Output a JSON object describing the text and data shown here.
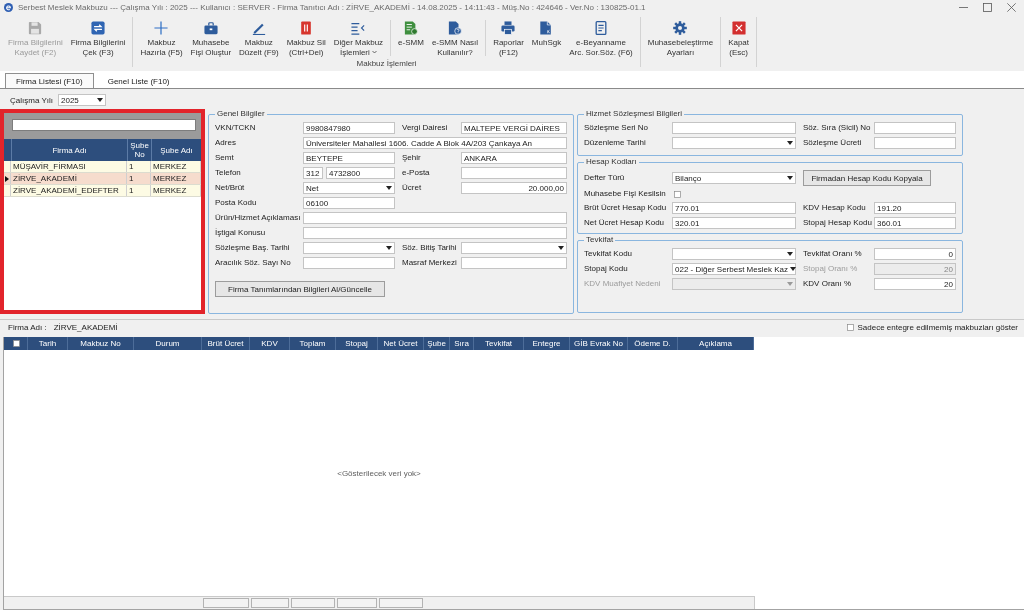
{
  "window": {
    "title": "Serbest Meslek Makbuzu --- Çalışma Yılı : 2025 --- Kullanıcı : SERVER - Firma Tanıtıcı Adı : ZİRVE_AKADEMİ - 14.08.2025 - 14:11:43 - Müş.No : 424646 - Ver.No : 130825-01.1"
  },
  "toolbar": {
    "groups": [
      {
        "sections": [
          [
            {
              "kind": "save",
              "label": "Firma Bilgilerini\nKaydet (F2)",
              "disabled": true,
              "menu": false
            },
            {
              "kind": "sync",
              "label": "Firma Bilgilerini\nÇek (F3)",
              "disabled": false,
              "menu": false
            }
          ]
        ]
      },
      {
        "label": "Makbuz İşlemleri",
        "sections": [
          [
            {
              "kind": "add",
              "label": "Makbuz\nHazırla (F5)",
              "disabled": false,
              "menu": false
            },
            {
              "kind": "briefcase",
              "label": "Muhasebe\nFişi Oluştur",
              "disabled": false,
              "menu": false
            },
            {
              "kind": "edit",
              "label": "Makbuz\nDüzelt (F9)",
              "disabled": false,
              "menu": false
            },
            {
              "kind": "delete",
              "label": "Makbuz Sil\n(Ctrl+Del)",
              "disabled": false,
              "menu": false
            },
            {
              "kind": "list",
              "label": "Diğer Makbuz\nİşlemleri",
              "disabled": false,
              "menu": true
            }
          ],
          [
            {
              "kind": "smm",
              "label": "e-SMM",
              "disabled": false,
              "menu": false
            },
            {
              "kind": "help",
              "label": "e-SMM Nasıl\nKullanılır?",
              "disabled": false,
              "menu": false
            }
          ],
          [
            {
              "kind": "print",
              "label": "Raporlar\n(F12)",
              "disabled": false,
              "menu": false
            },
            {
              "kind": "report",
              "label": "MuhSgk",
              "disabled": false,
              "menu": false
            },
            {
              "kind": "declaration",
              "label": "e-Beyanname\nArc. Sor.Söz. (F6)",
              "disabled": false,
              "menu": false
            }
          ]
        ]
      },
      {
        "sections": [
          [
            {
              "kind": "settings",
              "label": "Muhasebeleştirme\nAyarları",
              "disabled": false,
              "menu": false
            }
          ]
        ]
      },
      {
        "sections": [
          [
            {
              "kind": "close",
              "label": "Kapat\n(Esc)",
              "disabled": false,
              "menu": false
            }
          ]
        ]
      }
    ]
  },
  "tabs": [
    {
      "label": "Firma Listesi (F10)",
      "selected": true
    },
    {
      "label": "Genel Liste (F10)",
      "selected": false
    }
  ],
  "work_year": {
    "label": "Çalışma Yılı",
    "value": "2025"
  },
  "firm_list": {
    "columns": [
      "Firma Adı",
      "Şube\nNo",
      "Şube Adı"
    ],
    "rows": [
      {
        "cells": [
          "MÜŞAVİR_FİRMASI",
          "1",
          "MERKEZ"
        ],
        "selected": false
      },
      {
        "cells": [
          "ZİRVE_AKADEMİ",
          "1",
          "MERKEZ"
        ],
        "selected": true
      },
      {
        "cells": [
          "ZİRVE_AKADEMİ_EDEFTER",
          "1",
          "MERKEZ"
        ],
        "selected": false
      }
    ]
  },
  "general_info": {
    "title": "Genel Bilgiler",
    "rows": [
      [
        {
          "label": "VKN/TCKN",
          "kind": "text",
          "value": "9980847980"
        },
        {
          "label": "Vergi Dairesi",
          "kind": "text",
          "value": "MALTEPE VERGİ DAİRES"
        }
      ],
      [
        {
          "label": "Adres",
          "kind": "wide",
          "value": "Üniversiteler Mahallesi 1606. Cadde A Blok 4A/203 Çankaya An"
        }
      ],
      [
        {
          "label": "Semt",
          "kind": "text",
          "value": "BEYTEPE"
        },
        {
          "label": "Şehir",
          "kind": "text",
          "value": "ANKARA"
        }
      ],
      [
        {
          "label": "Telefon",
          "kind": "phone",
          "area_code": "312",
          "value": "4732800"
        },
        {
          "label": "e-Posta",
          "kind": "text"
        }
      ],
      [
        {
          "label": "Net/Brüt",
          "kind": "combo",
          "value": "Net"
        },
        {
          "label": "Ücret",
          "kind": "number",
          "value": "20.000,00"
        }
      ],
      [
        {
          "label": "Posta Kodu",
          "kind": "text",
          "value": "06100"
        }
      ],
      [
        {
          "label": "Ürün/Hizmet Açıklaması",
          "kind": "wide"
        }
      ],
      [
        {
          "label": "İştigal Konusu",
          "kind": "wide"
        }
      ],
      [
        {
          "label": "Sözleşme Baş. Tarihi",
          "kind": "combo"
        },
        {
          "label": "Söz. Bitiş Tarihi",
          "kind": "combo"
        }
      ],
      [
        {
          "label": "Aracılık Söz. Sayı No",
          "kind": "text"
        },
        {
          "label": "Masraf Merkezi",
          "kind": "text"
        }
      ]
    ],
    "update_button": "Firma Tanımlarından Bilgileri Al/Güncelle"
  },
  "contract_info": {
    "title": "Hizmet Sözleşmesi Bilgileri",
    "rows": [
      [
        {
          "label": "Sözleşme Seri No",
          "kind": "text"
        },
        {
          "label": "Söz. Sıra (Sicil) No",
          "kind": "text"
        }
      ],
      [
        {
          "label": "Düzenleme Tarihi",
          "kind": "combo"
        },
        {
          "label": "Sözleşme Ücreti",
          "kind": "text"
        }
      ]
    ]
  },
  "account_codes": {
    "title": "Hesap Kodları",
    "rows": [
      [
        {
          "label": "Defter Türü",
          "kind": "combo",
          "value": "Bilanço"
        },
        {
          "label": "Firmadan Hesap Kodu Kopyala",
          "kind": "button"
        }
      ],
      [
        {
          "label": "Muhasebe Fişi Kesilsin",
          "kind": "checkbox",
          "checked": false
        }
      ],
      [
        {
          "label": "Brüt Ücret Hesap Kodu",
          "kind": "text",
          "value": "770.01"
        },
        {
          "label": "KDV Hesap Kodu",
          "kind": "text",
          "value": "191.20"
        }
      ],
      [
        {
          "label": "Net Ücret Hesap Kodu",
          "kind": "text",
          "value": "320.01"
        },
        {
          "label": "Stopaj Hesap Kodu",
          "kind": "text",
          "value": "360.01"
        }
      ]
    ]
  },
  "withholding": {
    "title": "Tevkifat",
    "rows": [
      [
        {
          "label": "Tevkifat Kodu",
          "kind": "combo",
          "disabled": false
        },
        {
          "label": "Tevkifat Oranı %",
          "kind": "number",
          "value": "0",
          "disabled": false
        }
      ],
      [
        {
          "label": "Stopaj Kodu",
          "kind": "combo",
          "value": "022 - Diğer Serbest Meslek Kaz",
          "disabled": false
        },
        {
          "label": "Stopaj Oranı %",
          "kind": "number",
          "value": "20",
          "disabled": true
        }
      ],
      [
        {
          "label": "KDV Muafiyet Nedeni",
          "kind": "combo",
          "disabled": true
        },
        {
          "label": "KDV Oranı %",
          "kind": "number",
          "value": "20",
          "disabled": false
        }
      ]
    ]
  },
  "firm_name_bar": {
    "label": "Firma Adı :",
    "value": "ZİRVE_AKADEMİ"
  },
  "only_unintegrated": {
    "label": "Sadece entegre edilmemiş makbuzları göster",
    "checked": false
  },
  "receipts_table": {
    "select_all_checked": false,
    "columns": [
      {
        "label": "Tarih",
        "total_cell": false
      },
      {
        "label": "Makbuz No",
        "total_cell": false
      },
      {
        "label": "Durum",
        "total_cell": false
      },
      {
        "label": "Brüt Ücret",
        "total_cell": true
      },
      {
        "label": "KDV",
        "total_cell": true
      },
      {
        "label": "Toplam",
        "total_cell": true
      },
      {
        "label": "Stopaj",
        "total_cell": true
      },
      {
        "label": "Net Ücret",
        "total_cell": true
      },
      {
        "label": "Şube",
        "total_cell": false
      },
      {
        "label": "Sıra",
        "total_cell": false
      },
      {
        "label": "Tevkifat",
        "total_cell": false
      },
      {
        "label": "Entegre",
        "total_cell": false
      },
      {
        "label": "GİB Evrak No",
        "total_cell": false
      },
      {
        "label": "Ödeme D.",
        "total_cell": false
      },
      {
        "label": "Açıklama",
        "total_cell": false
      }
    ],
    "empty_text": "<Gösterilecek veri yok>"
  }
}
